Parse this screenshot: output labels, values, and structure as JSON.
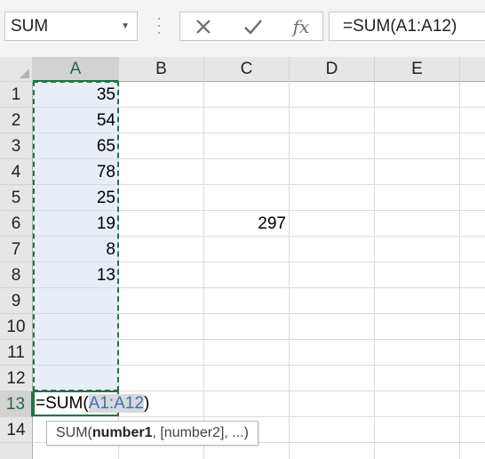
{
  "name_box": {
    "value": "SUM"
  },
  "formula_bar": {
    "cancel_icon": "x-icon",
    "enter_icon": "check-icon",
    "fx_label": "fx",
    "content": "=SUM(A1:A12)"
  },
  "columns": [
    "A",
    "B",
    "C",
    "D",
    "E"
  ],
  "rows": [
    "1",
    "2",
    "3",
    "4",
    "5",
    "6",
    "7",
    "8",
    "9",
    "10",
    "11",
    "12",
    "13",
    "14"
  ],
  "active_column": "A",
  "active_row": "13",
  "cells": {
    "A1": "35",
    "A2": "54",
    "A3": "65",
    "A4": "78",
    "A5": "25",
    "A6": "19",
    "A7": "8",
    "A8": "13",
    "C6": "297"
  },
  "edit_cell": {
    "prefix": "=SUM(",
    "range": "A1:A12",
    "suffix": ")"
  },
  "tooltip": {
    "func": "SUM(",
    "arg1": "number1",
    "rest": ", [number2], ...)"
  },
  "colors": {
    "accent": "#217346",
    "range_ref": "#3a6fc4",
    "selection_fill": "#e8eef8"
  }
}
